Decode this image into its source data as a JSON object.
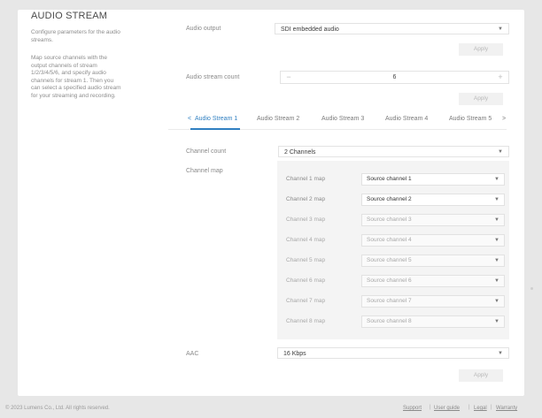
{
  "section": {
    "title": "AUDIO STREAM",
    "desc1": "Configure parameters for the audio streams.",
    "desc2": "Map source channels with the output channels of stream 1/2/3/4/5/6, and specify audio channels for stream 1. Then you can select a specified audio stream for your streaming and recording."
  },
  "audio_output": {
    "label": "Audio output",
    "value": "SDI embedded audio",
    "apply": "Apply"
  },
  "stream_count": {
    "label": "Audio stream count",
    "value": "6",
    "minus": "−",
    "plus": "+",
    "apply": "Apply"
  },
  "tabs": {
    "prev": "<",
    "next": ">",
    "items": [
      "Audio Stream 1",
      "Audio Stream 2",
      "Audio Stream 3",
      "Audio Stream 4",
      "Audio Stream 5"
    ]
  },
  "channel_count": {
    "label": "Channel count",
    "value": "2 Channels"
  },
  "channel_map": {
    "label": "Channel map",
    "rows": [
      {
        "label": "Channel 1 map",
        "value": "Source channel 1"
      },
      {
        "label": "Channel 2 map",
        "value": "Source channel 2"
      },
      {
        "label": "Channel 3 map",
        "value": "Source channel 3"
      },
      {
        "label": "Channel 4 map",
        "value": "Source channel 4"
      },
      {
        "label": "Channel 5 map",
        "value": "Source channel 5"
      },
      {
        "label": "Channel 6 map",
        "value": "Source channel 6"
      },
      {
        "label": "Channel 7 map",
        "value": "Source channel 7"
      },
      {
        "label": "Channel 8 map",
        "value": "Source channel 8"
      }
    ]
  },
  "aac": {
    "label": "AAC",
    "value": "16 Kbps",
    "apply": "Apply"
  },
  "caret": "▼",
  "footer": {
    "copyright": "© 2023 Lumens Co., Ltd. All rights reserved.",
    "links": [
      "Support",
      "User guide",
      "Legal",
      "Warranty"
    ],
    "sep": "|"
  }
}
